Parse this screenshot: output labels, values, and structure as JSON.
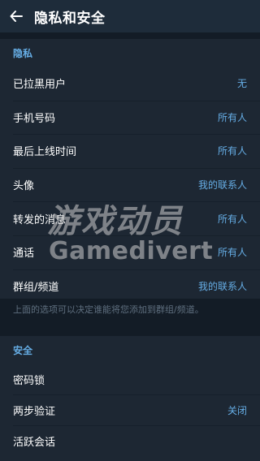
{
  "header": {
    "title": "隐私和安全"
  },
  "privacy": {
    "header": "隐私",
    "items": [
      {
        "label": "已拉黑用户",
        "value": "无"
      },
      {
        "label": "手机号码",
        "value": "所有人"
      },
      {
        "label": "最后上线时间",
        "value": "所有人"
      },
      {
        "label": "头像",
        "value": "我的联系人"
      },
      {
        "label": "转发的消息",
        "value": "所有人"
      },
      {
        "label": "通话",
        "value": "所有人"
      },
      {
        "label": "群组/频道",
        "value": "我的联系人"
      }
    ],
    "hint": "上面的选项可以决定谁能将您添加到群组/频道。"
  },
  "security": {
    "header": "安全",
    "items": [
      {
        "label": "密码锁",
        "value": ""
      },
      {
        "label": "两步验证",
        "value": "关闭"
      },
      {
        "label": "活跃会话",
        "value": ""
      }
    ]
  },
  "watermark": {
    "cn": "游戏动员",
    "en": "Gamedivert"
  },
  "colors": {
    "accent": "#66aee6",
    "background": "#131c26",
    "surface": "#1d2733",
    "appbar": "#1e2c3a"
  }
}
